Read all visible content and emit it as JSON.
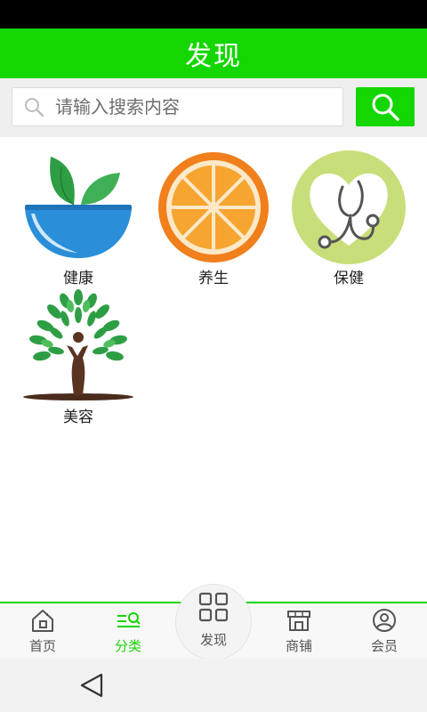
{
  "header": {
    "title": "发现"
  },
  "search": {
    "placeholder": "请输入搜索内容",
    "icon": "search-icon"
  },
  "categories": [
    {
      "label": "健康",
      "icon": "plant-bowl-icon"
    },
    {
      "label": "养生",
      "icon": "orange-slice-icon"
    },
    {
      "label": "保健",
      "icon": "stethoscope-heart-icon"
    },
    {
      "label": "美容",
      "icon": "tree-figure-icon"
    }
  ],
  "tabbar": {
    "items": [
      {
        "label": "首页",
        "icon": "home-icon"
      },
      {
        "label": "分类",
        "icon": "category-icon",
        "active": true
      },
      {
        "label": "发现",
        "icon": "grid-icon"
      },
      {
        "label": "商铺",
        "icon": "shop-icon"
      },
      {
        "label": "会员",
        "icon": "user-icon"
      }
    ]
  },
  "colors": {
    "accent": "#14d600",
    "active_tab": "#14d600"
  }
}
